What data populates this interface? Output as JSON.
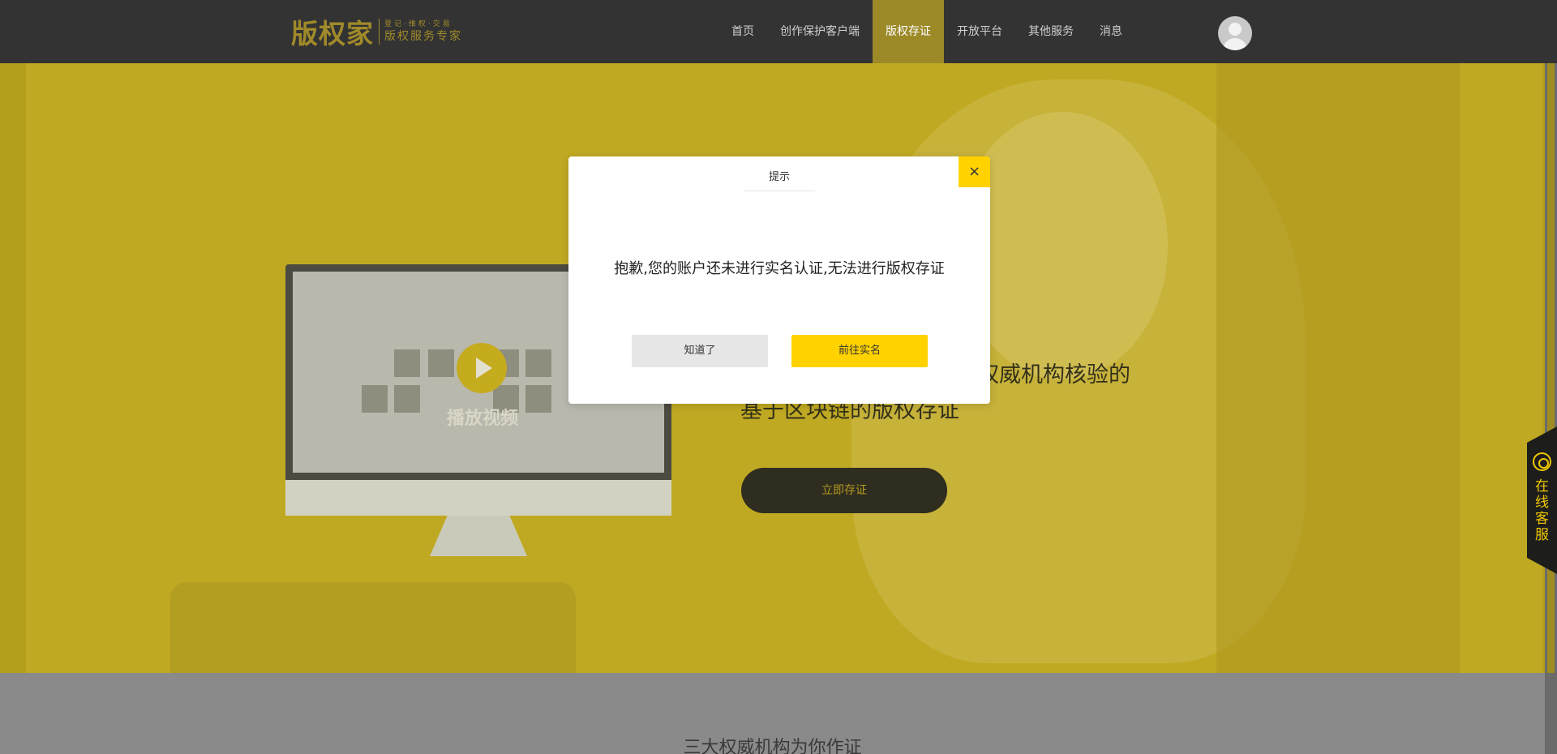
{
  "header": {
    "logo": {
      "main": "版权家",
      "tagline_top": "登记·维权·交易",
      "tagline_bottom": "版权服务专家"
    },
    "nav": [
      {
        "label": "首页",
        "active": false
      },
      {
        "label": "创作保护客户端",
        "active": false
      },
      {
        "label": "版权存证",
        "active": true
      },
      {
        "label": "开放平台",
        "active": false
      },
      {
        "label": "其他服务",
        "active": false
      },
      {
        "label": "消息",
        "active": false
      }
    ]
  },
  "hero": {
    "video_label": "播放视频",
    "line1": "权威机构核验的",
    "line2": "基于区块链的版权存证",
    "cta_label": "立即存证"
  },
  "bottom": {
    "section_title": "三大权威机构为你作证"
  },
  "service_tab": {
    "label": "在线客服"
  },
  "modal": {
    "title": "提示",
    "close_glyph": "×",
    "message": "抱歉,您的账户还未进行实名认证,无法进行版权存证",
    "ok_label": "知道了",
    "go_label": "前往实名"
  },
  "colors": {
    "header_bg": "#333333",
    "accent_gold": "#ffd200",
    "nav_active": "#9c8a28",
    "hero_overlay": "#b49f1c"
  },
  "icons": [
    "user-avatar-icon",
    "play-icon",
    "headset-icon",
    "close-icon"
  ]
}
